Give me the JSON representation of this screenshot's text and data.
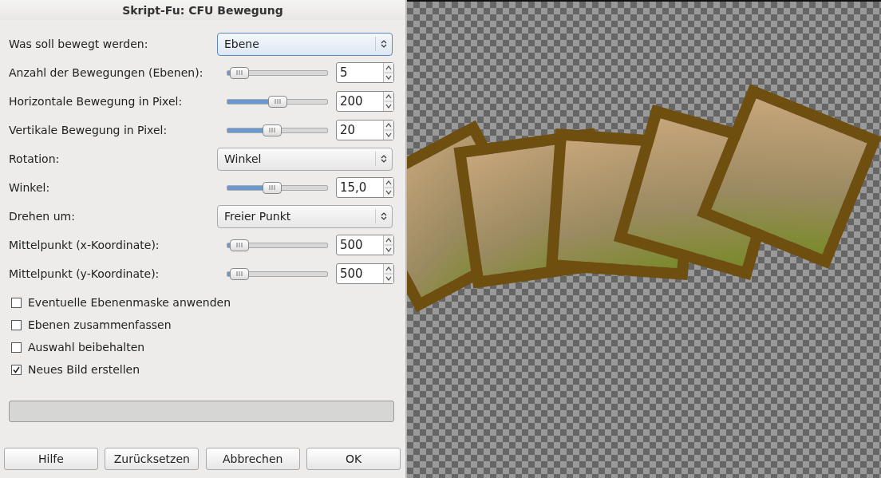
{
  "window": {
    "title": "Skript-Fu: CFU Bewegung"
  },
  "fields": [
    {
      "kind": "combo",
      "label": "Was soll bewegt werden:",
      "value": "Ebene",
      "focused": true
    },
    {
      "kind": "slider",
      "label": "Anzahl der Bewegungen (Ebenen):",
      "value": "5",
      "level": 0.03
    },
    {
      "kind": "slider",
      "label": "Horizontale Bewegung in Pixel:",
      "value": "200",
      "level": 0.5
    },
    {
      "kind": "slider",
      "label": "Vertikale Bewegung in Pixel:",
      "value": "20",
      "level": 0.44
    },
    {
      "kind": "combo",
      "label": "Rotation:",
      "value": "Winkel",
      "focused": false
    },
    {
      "kind": "slider",
      "label": "Winkel:",
      "value": "15,0",
      "level": 0.44
    },
    {
      "kind": "combo",
      "label": "Drehen um:",
      "value": "Freier Punkt",
      "focused": false
    },
    {
      "kind": "slider",
      "label": "Mittelpunkt (x-Koordinate):",
      "value": "500",
      "level": 0.03
    },
    {
      "kind": "slider",
      "label": "Mittelpunkt (y-Koordinate):",
      "value": "500",
      "level": 0.03
    }
  ],
  "options": [
    {
      "label": "Eventuelle Ebenenmaske anwenden",
      "checked": false
    },
    {
      "label": "Ebenen zusammenfassen",
      "checked": false
    },
    {
      "label": "Auswahl beibehalten",
      "checked": false
    },
    {
      "label": "Neues Bild erstellen",
      "checked": true
    }
  ],
  "progress": {
    "level": 0
  },
  "buttons": [
    "Hilfe",
    "Zurücksetzen",
    "Abbrechen",
    "OK"
  ]
}
